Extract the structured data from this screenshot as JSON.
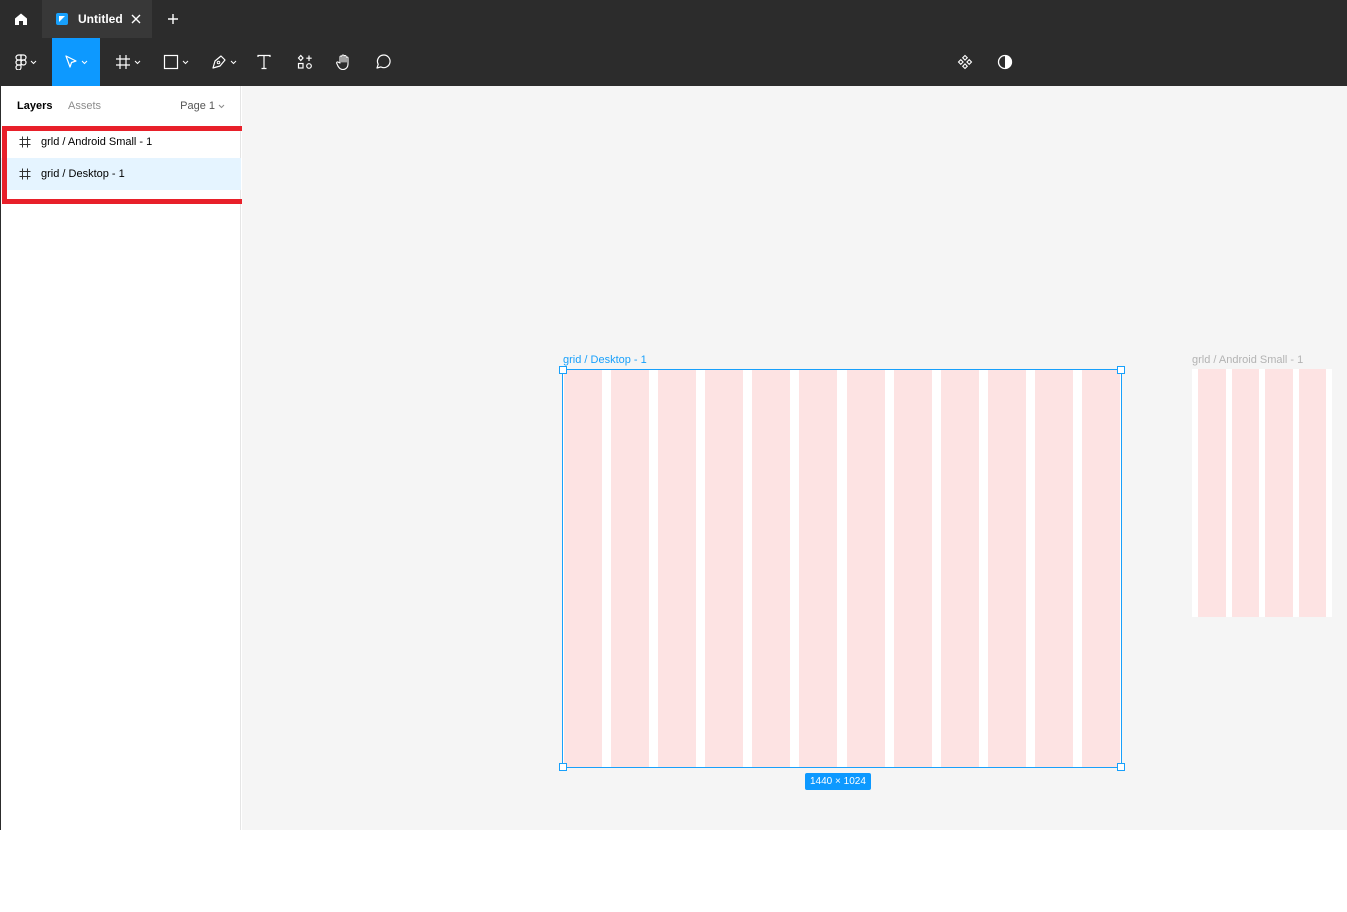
{
  "tab": {
    "title": "Untitled"
  },
  "panel": {
    "tabs": {
      "layers": "Layers",
      "assets": "Assets"
    },
    "page": "Page 1"
  },
  "layers": [
    {
      "name": "grld / Android Small - 1"
    },
    {
      "name": "grid / Desktop - 1"
    }
  ],
  "canvas": {
    "desktop_frame": {
      "label": "grid / Desktop - 1",
      "size": "1440 × 1024",
      "columns": 12
    },
    "android_frame": {
      "label": "grld / Android Small - 1",
      "columns": 4
    }
  },
  "colors": {
    "accent": "#0d99ff",
    "selection": "#18a0fb",
    "highlight_box": "#e8202a",
    "grid_column": "#fde3e3",
    "chrome": "#2c2c2c"
  },
  "icons": {
    "tabbar": [
      "home-icon",
      "file-icon",
      "close-icon",
      "plus-icon"
    ],
    "toolbar": [
      "figma-menu-icon",
      "move-tool-icon",
      "frame-tool-icon",
      "rectangle-tool-icon",
      "pen-tool-icon",
      "text-tool-icon",
      "resources-icon",
      "hand-tool-icon",
      "comment-tool-icon",
      "components-icon",
      "contrast-icon"
    ]
  }
}
